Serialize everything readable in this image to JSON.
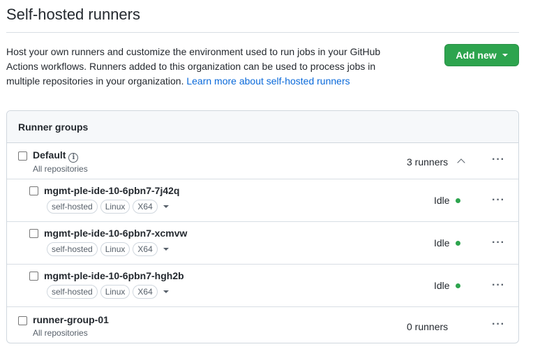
{
  "page": {
    "title": "Self-hosted runners",
    "intro_text": "Host your own runners and customize the environment used to run jobs in your GitHub Actions workflows. Runners added to this organization can be used to process jobs in multiple repositories in your organization. ",
    "learn_more": "Learn more about self-hosted runners",
    "add_new": "Add new"
  },
  "runner_groups": {
    "header": "Runner groups",
    "default_group": {
      "name": "Default",
      "scope": "All repositories",
      "count": "3 runners"
    },
    "runners": [
      {
        "name": "mgmt-ple-ide-10-6pbn7-7j42q",
        "labels": [
          "self-hosted",
          "Linux",
          "X64"
        ],
        "status": "Idle"
      },
      {
        "name": "mgmt-ple-ide-10-6pbn7-xcmvw",
        "labels": [
          "self-hosted",
          "Linux",
          "X64"
        ],
        "status": "Idle"
      },
      {
        "name": "mgmt-ple-ide-10-6pbn7-hgh2b",
        "labels": [
          "self-hosted",
          "Linux",
          "X64"
        ],
        "status": "Idle"
      }
    ],
    "group_two": {
      "name": "runner-group-01",
      "scope": "All repositories",
      "count": "0 runners"
    }
  },
  "icons": {
    "info": "info-icon",
    "kebab": "kebab-horizontal-icon",
    "chevron": "chevron-up-icon"
  },
  "colors": {
    "primary_button": "#2da44e",
    "link": "#0969da",
    "status_idle": "#2da44e"
  }
}
